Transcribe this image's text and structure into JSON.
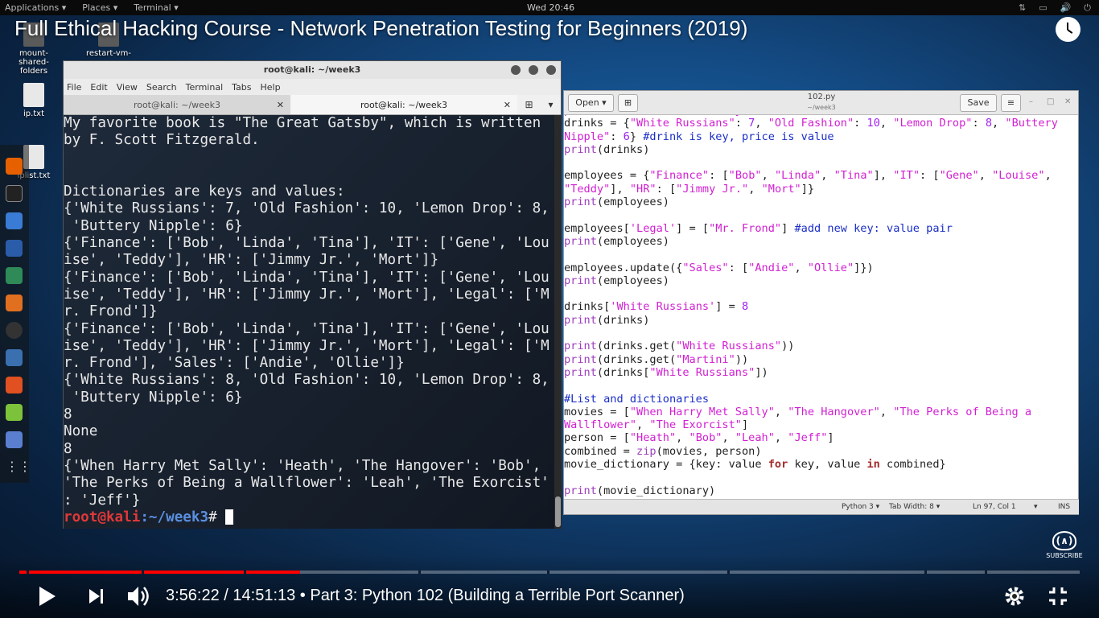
{
  "topbar": {
    "applications": "Applications ▾",
    "places": "Places ▾",
    "terminal": "Terminal ▾",
    "clock": "Wed 20:46"
  },
  "video": {
    "title": "Full Ethical Hacking Course - Network Penetration Testing for Beginners (2019)",
    "time": "3:56:22 / 14:51:13 • Part 3: Python 102 (Building a Terrible Port Scanner)",
    "progress_fraction": 0.265,
    "subscribe": "SUBSCRIBE"
  },
  "desktop": {
    "icons": [
      "mount-shared-folders",
      "restart-vm-",
      "ip.txt",
      "iplist.txt"
    ]
  },
  "terminal": {
    "title": "root@kali: ~/week3",
    "menu": [
      "File",
      "Edit",
      "View",
      "Search",
      "Terminal",
      "Tabs",
      "Help"
    ],
    "tabs": [
      "root@kali: ~/week3",
      "root@kali: ~/week3"
    ],
    "lines": [
      "My favorite book is \"The Great Gatsby\", which is written",
      "by F. Scott Fitzgerald.",
      "",
      "",
      "Dictionaries are keys and values:",
      "{'White Russians': 7, 'Old Fashion': 10, 'Lemon Drop': 8,",
      " 'Buttery Nipple': 6}",
      "{'Finance': ['Bob', 'Linda', 'Tina'], 'IT': ['Gene', 'Lou",
      "ise', 'Teddy'], 'HR': ['Jimmy Jr.', 'Mort']}",
      "{'Finance': ['Bob', 'Linda', 'Tina'], 'IT': ['Gene', 'Lou",
      "ise', 'Teddy'], 'HR': ['Jimmy Jr.', 'Mort'], 'Legal': ['M",
      "r. Frond']}",
      "{'Finance': ['Bob', 'Linda', 'Tina'], 'IT': ['Gene', 'Lou",
      "ise', 'Teddy'], 'HR': ['Jimmy Jr.', 'Mort'], 'Legal': ['M",
      "r. Frond'], 'Sales': ['Andie', 'Ollie']}",
      "{'White Russians': 8, 'Old Fashion': 10, 'Lemon Drop': 8,",
      " 'Buttery Nipple': 6}",
      "8",
      "None",
      "8",
      "{'When Harry Met Sally': 'Heath', 'The Hangover': 'Bob',",
      "'The Perks of Being a Wallflower': 'Leah', 'The Exorcist'",
      ": 'Jeff'}"
    ],
    "prompt_user": "root@kali",
    "prompt_path": ":~/week3",
    "prompt_hash": "# "
  },
  "editor": {
    "open_label": "Open",
    "save_label": "Save",
    "filename": "102.py",
    "path": "~/week3",
    "status": {
      "language": "Python 3 ▾",
      "tab_width": "Tab Width: 8 ▾",
      "position": "Ln 97, Col 1",
      "mode": "INS"
    }
  }
}
